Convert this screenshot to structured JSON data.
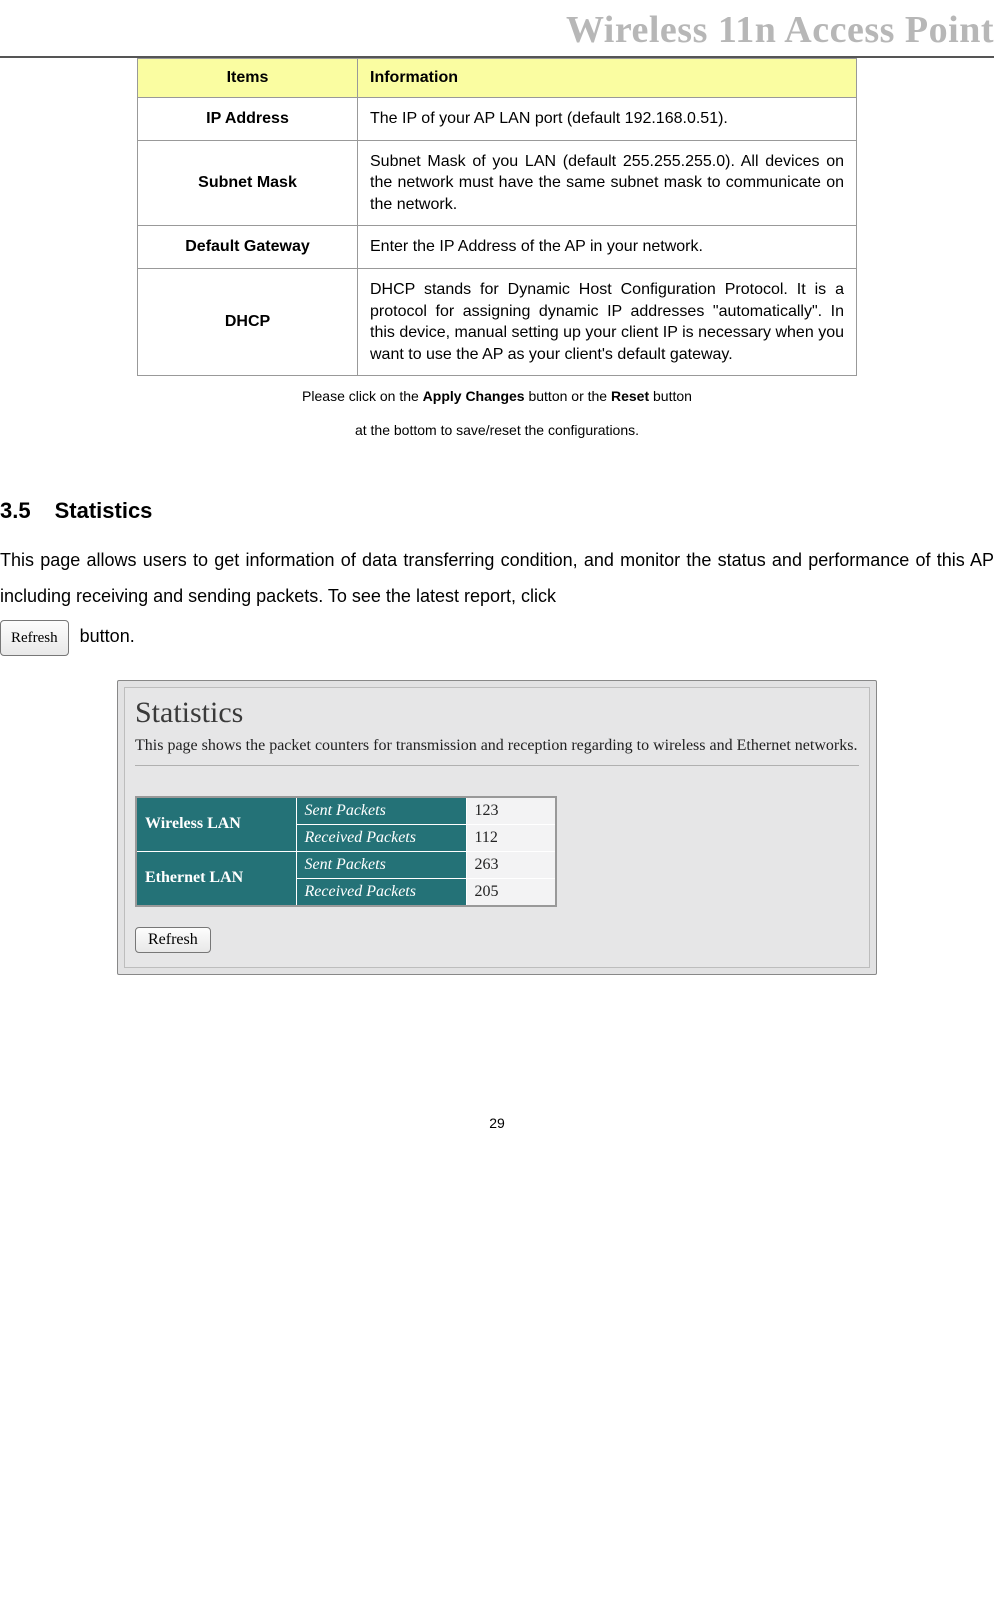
{
  "header": {
    "title": "Wireless 11n Access Point"
  },
  "items_table": {
    "columns": {
      "items": "Items",
      "info": "Information"
    },
    "rows": [
      {
        "item": "IP Address",
        "info": "The IP of your AP LAN port (default 192.168.0.51)."
      },
      {
        "item": "Subnet Mask",
        "info": "Subnet Mask of you LAN (default 255.255.255.0). All devices on the network must have the same subnet mask to communicate on the network."
      },
      {
        "item": "Default Gateway",
        "info": "Enter the IP Address of the AP in your network."
      },
      {
        "item": "DHCP",
        "info": "DHCP stands for Dynamic Host Configuration Protocol. It is a protocol for assigning dynamic IP addresses \"automatically\". In this device, manual setting up your client IP is necessary when you want to use the AP as your client's default gateway."
      }
    ]
  },
  "caption": {
    "prefix": "Please click on the ",
    "apply": "Apply Changes",
    "mid": " button or the ",
    "reset": "Reset",
    "suffix": " button",
    "line2": "at the bottom to save/reset the configurations."
  },
  "section": {
    "num": "3.5",
    "title": "Statistics"
  },
  "body": {
    "p1a": "This page allows users to get information of data transferring condition, and monitor the status and performance of this AP including receiving and sending packets. To see the latest report, click",
    "refresh_inline": "Refresh",
    "p1b": " button."
  },
  "screenshot": {
    "title": "Statistics",
    "subtitle": "This page shows the packet counters for transmission and reception regarding to wireless and Ethernet networks.",
    "groups": [
      {
        "name": "Wireless LAN",
        "rows": [
          {
            "label": "Sent Packets",
            "value": "123"
          },
          {
            "label": "Received Packets",
            "value": "112"
          }
        ]
      },
      {
        "name": "Ethernet LAN",
        "rows": [
          {
            "label": "Sent Packets",
            "value": "263"
          },
          {
            "label": "Received Packets",
            "value": "205"
          }
        ]
      }
    ],
    "refresh": "Refresh"
  },
  "footer": {
    "page": "29"
  }
}
